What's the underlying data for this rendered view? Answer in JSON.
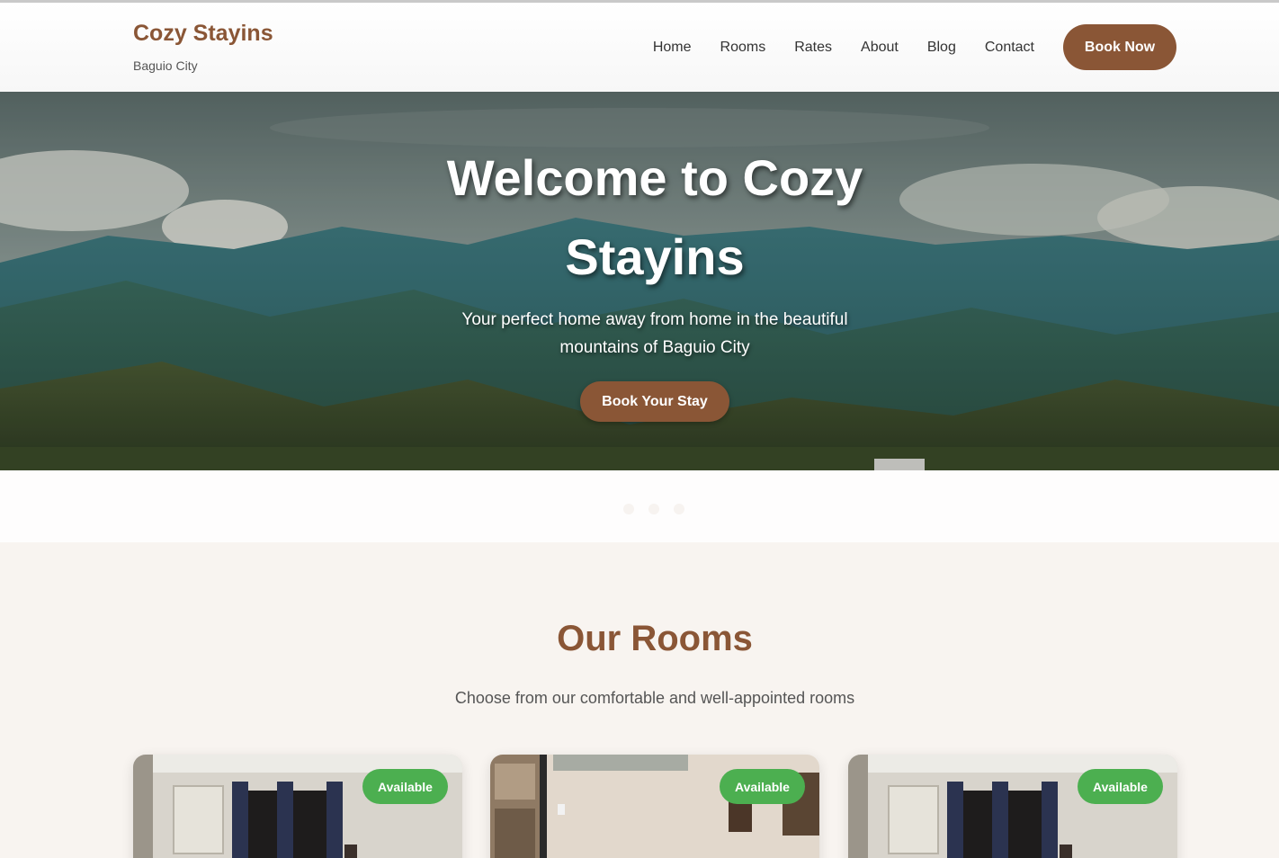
{
  "brand": {
    "name": "Cozy Stayins",
    "location": "Baguio City"
  },
  "nav": {
    "items": [
      {
        "label": "Home"
      },
      {
        "label": "Rooms"
      },
      {
        "label": "Rates"
      },
      {
        "label": "About"
      },
      {
        "label": "Blog"
      },
      {
        "label": "Contact"
      }
    ],
    "book_label": "Book Now"
  },
  "hero": {
    "title": "Welcome to Cozy Stayins",
    "subtitle": "Your perfect home away from home in the beautiful mountains of Baguio City",
    "cta_label": "Book Your Stay",
    "slide_count": 3
  },
  "rooms": {
    "title": "Our Rooms",
    "subtitle": "Choose from our comfortable and well-appointed rooms",
    "cards": [
      {
        "badge": "Available"
      },
      {
        "badge": "Available"
      },
      {
        "badge": "Available"
      }
    ]
  },
  "colors": {
    "brand": "#8a5636",
    "available": "#4caf50",
    "section_bg": "#f8f4f0"
  }
}
